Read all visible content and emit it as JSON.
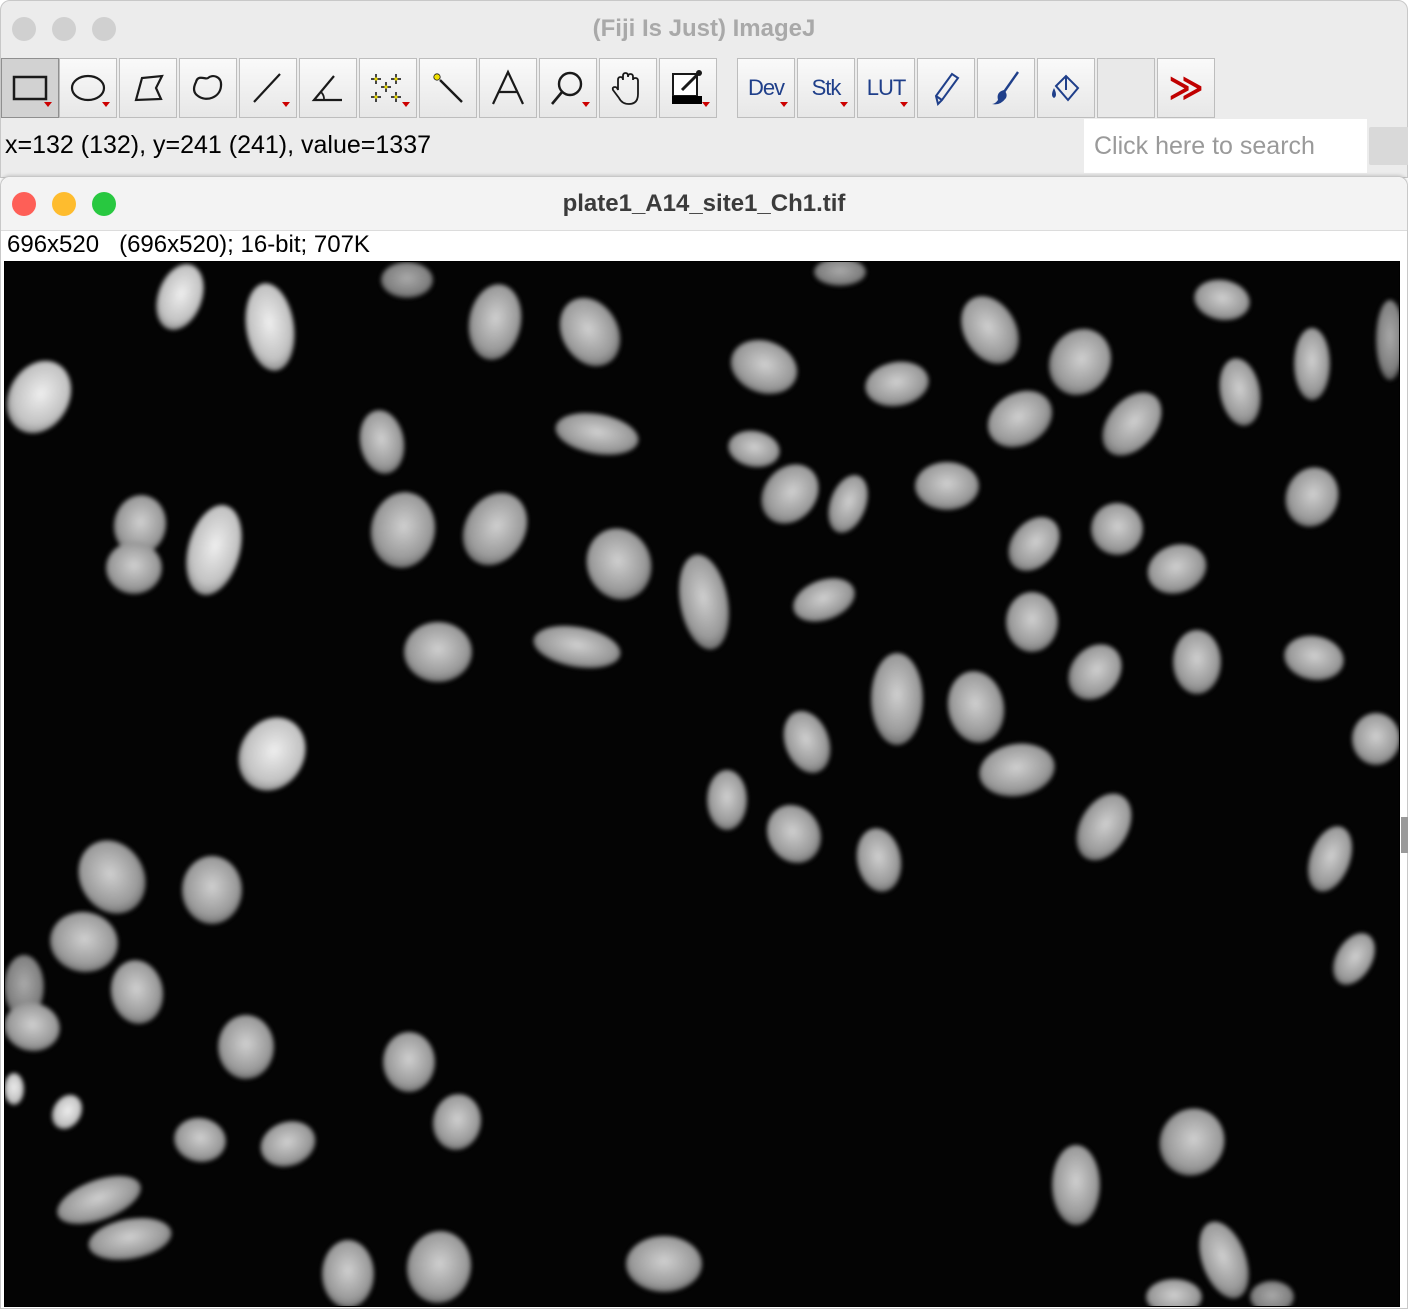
{
  "main_window": {
    "title": "(Fiji Is Just) ImageJ",
    "traffic_lights": [
      "inactive-close",
      "inactive-minimize",
      "inactive-zoom"
    ]
  },
  "toolbar": {
    "tools": [
      {
        "name": "rectangle-tool",
        "icon": "rectangle-icon",
        "selected": true,
        "dropdown": true
      },
      {
        "name": "oval-tool",
        "icon": "oval-icon",
        "dropdown": true
      },
      {
        "name": "polygon-tool",
        "icon": "polygon-icon"
      },
      {
        "name": "freehand-tool",
        "icon": "freehand-icon"
      },
      {
        "name": "line-tool",
        "icon": "line-icon",
        "dropdown": true
      },
      {
        "name": "angle-tool",
        "icon": "angle-icon"
      },
      {
        "name": "point-tool",
        "icon": "multipoint-icon",
        "dropdown": true
      },
      {
        "name": "wand-tool",
        "icon": "magic-wand-icon"
      },
      {
        "name": "text-tool",
        "icon": "text-tool-icon",
        "label": "A"
      },
      {
        "name": "zoom-tool",
        "icon": "magnifier-icon",
        "dropdown": true
      },
      {
        "name": "hand-tool",
        "icon": "hand-icon"
      },
      {
        "name": "color-picker-tool",
        "icon": "color-picker-icon",
        "dropdown": true
      },
      {
        "name": "dev-menu",
        "label": "Dev",
        "dropdown": true
      },
      {
        "name": "stk-menu",
        "label": "Stk",
        "dropdown": true
      },
      {
        "name": "lut-menu",
        "label": "LUT",
        "dropdown": true
      },
      {
        "name": "pencil-tool",
        "icon": "pencil-icon"
      },
      {
        "name": "brush-tool",
        "icon": "brush-icon"
      },
      {
        "name": "flood-fill-tool",
        "icon": "paint-bucket-icon"
      },
      {
        "name": "empty-slot"
      },
      {
        "name": "more-tools",
        "label": "≫"
      }
    ]
  },
  "status": {
    "coords": "x=132 (132), y=241 (241), value=1337",
    "search_placeholder": "Click here to search"
  },
  "image_window": {
    "title": "plate1_A14_site1_Ch1.tif",
    "traffic_lights": [
      "close",
      "minimize",
      "zoom"
    ],
    "info": "696x520   (696x520); 16-bit; 707K"
  },
  "colors": {
    "close": "#fe5f57",
    "minimize": "#febc2e",
    "zoom": "#28c840",
    "inactive": "#d0d0d0",
    "image_background": "#040404",
    "accent_red": "#cc0000",
    "menu_blue": "#1f3f8a"
  }
}
